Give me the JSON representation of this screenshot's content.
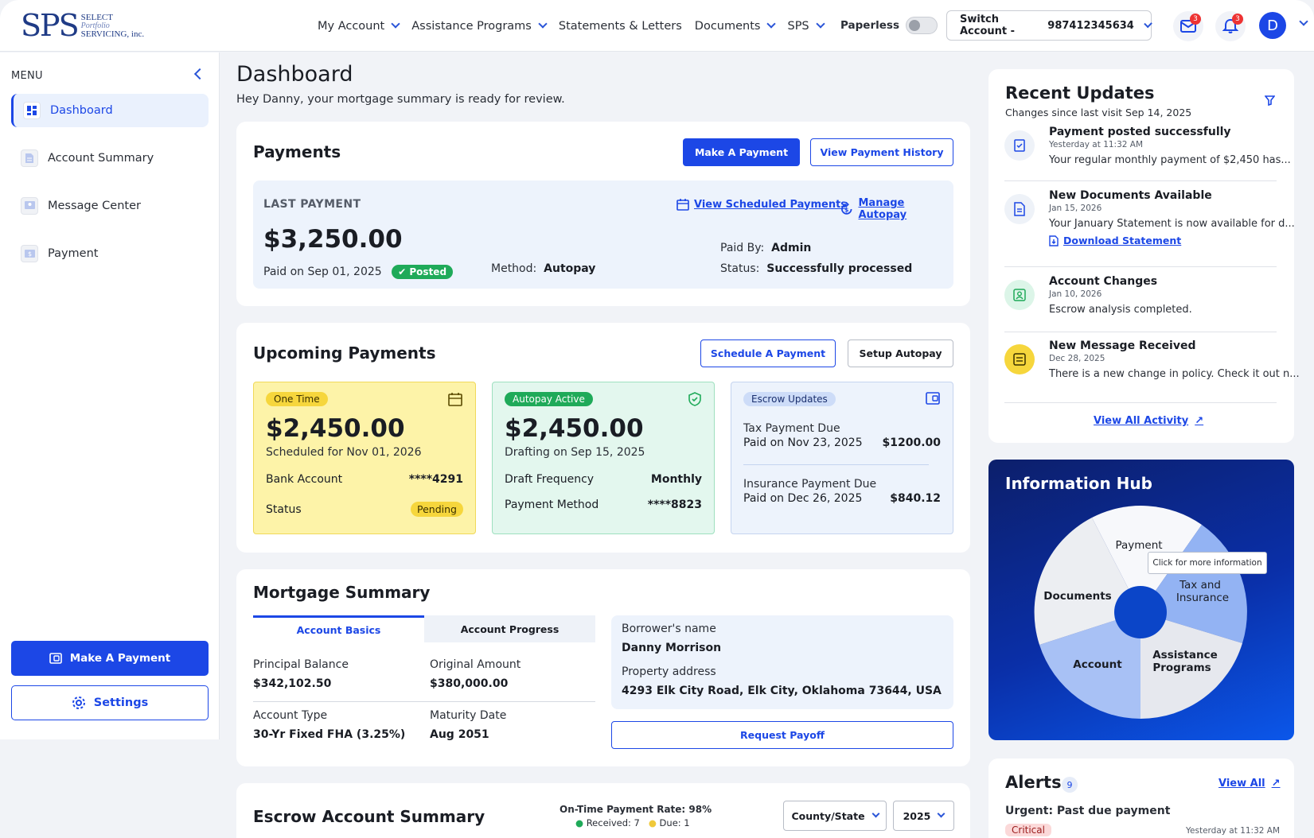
{
  "logo": {
    "mark": "SPS",
    "line1": "SELECT",
    "line2": "Portfolio",
    "line3": "SERVICING, inc."
  },
  "nav": [
    {
      "label": "My Account",
      "dropdown": true
    },
    {
      "label": "Assistance Programs",
      "dropdown": true
    },
    {
      "label": "Statements & Letters",
      "dropdown": false
    },
    {
      "label": "Documents",
      "dropdown": true
    },
    {
      "label": "SPS",
      "dropdown": true
    }
  ],
  "header": {
    "paperless_label": "Paperless",
    "switch_account": "Switch Account - ",
    "account_number": "987412345634",
    "mail_badge": "3",
    "bell_badge": "3",
    "avatar": "D"
  },
  "sidebar": {
    "menu_label": "MENU",
    "items": [
      {
        "label": "Dashboard",
        "active": true
      },
      {
        "label": "Account Summary",
        "active": false
      },
      {
        "label": "Message Center",
        "active": false
      },
      {
        "label": "Payment",
        "active": false
      }
    ],
    "make_payment": "Make A Payment",
    "settings": "Settings"
  },
  "page": {
    "title": "Dashboard",
    "subtitle": "Hey Danny, your mortgage summary is ready for review."
  },
  "payments": {
    "title": "Payments",
    "make_payment": "Make A Payment",
    "view_history": "View Payment History",
    "last_label": "LAST PAYMENT",
    "view_scheduled": "View Scheduled Payments",
    "manage_autopay": "Manage Autopay",
    "amount": "$3,250.00",
    "paid_on": "Paid on Sep 01, 2025",
    "posted": "Posted",
    "method_label": "Method:",
    "method_value": "Autopay",
    "paid_by_label": "Paid By:",
    "paid_by_value": "Admin",
    "status_label": "Status:",
    "status_value": "Successfully processed"
  },
  "upcoming": {
    "title": "Upcoming Payments",
    "schedule": "Schedule A Payment",
    "setup": "Setup Autopay",
    "one_time": {
      "tag": "One Time",
      "amount": "$2,450.00",
      "scheduled": "Scheduled for Nov 01, 2026",
      "bank_label": "Bank Account",
      "bank_value": "****4291",
      "status_label": "Status",
      "status_value": "Pending"
    },
    "autopay": {
      "tag": "Autopay Active",
      "amount": "$2,450.00",
      "drafting": "Drafting on Sep 15, 2025",
      "freq_label": "Draft Frequency",
      "freq_value": "Monthly",
      "method_label": "Payment Method",
      "method_value": "****8823"
    },
    "escrow": {
      "tag": "Escrow Updates",
      "tax_title": "Tax Payment Due",
      "tax_date": "Paid on Nov 23, 2025",
      "tax_amount": "$1200.00",
      "ins_title": "Insurance Payment Due",
      "ins_date": "Paid on Dec 26, 2025",
      "ins_amount": "$840.12"
    }
  },
  "mortgage": {
    "title": "Mortgage Summary",
    "tab_basics": "Account Basics",
    "tab_progress": "Account Progress",
    "principal_label": "Principal Balance",
    "principal_value": "$342,102.50",
    "original_label": "Original Amount",
    "original_value": "$380,000.00",
    "type_label": "Account Type",
    "type_value": "30-Yr Fixed FHA (3.25%)",
    "maturity_label": "Maturity Date",
    "maturity_value": "Aug 2051",
    "borrower_label": "Borrower's name",
    "borrower_value": "Danny Morrison",
    "property_label": "Property address",
    "property_value": "4293 Elk City Road, Elk City, Oklahoma 73644, USA",
    "request_payoff": "Request Payoff"
  },
  "escrow_summary": {
    "title": "Escrow Account Summary",
    "rate": "On-Time Payment Rate: 98%",
    "received": "Received: 7",
    "due": "Due: 1",
    "county": "County/State",
    "year": "2025"
  },
  "recent": {
    "title": "Recent Updates",
    "since": "Changes since last visit Sep 14, 2025",
    "items": [
      {
        "title": "Payment posted successfully",
        "time": "Yesterday at 11:32 AM",
        "desc": "Your regular monthly payment of $2,450 has..."
      },
      {
        "title": "New Documents Available",
        "time": "Jan 15, 2026",
        "desc": "Your January Statement is now available for d...",
        "link": "Download Statement"
      },
      {
        "title": "Account Changes",
        "time": "Jan 10, 2026",
        "desc": "Escrow analysis completed."
      },
      {
        "title": "New Message Received",
        "time": "Dec 28, 2025",
        "desc": "There is a new change in policy. Check it out n..."
      }
    ],
    "view_all": "View All Activity"
  },
  "hub": {
    "title": "Information Hub",
    "tooltip": "Click for more information",
    "segments": [
      "Payment",
      "Tax and",
      "Insurance",
      "Assistance",
      "Programs",
      "Account",
      "Documents"
    ]
  },
  "alerts": {
    "title": "Alerts",
    "count": "9",
    "view_all": "View All",
    "item_title": "Urgent: Past due payment",
    "item_tag": "Critical",
    "item_time": "Yesterday at 11:32 AM"
  },
  "colors": {
    "primary": "#1c47e6",
    "posted": "#1faa59",
    "one_time_bg": "#fdf3a8",
    "autopay_bg": "#e3f7ee",
    "escrow_bg": "#edf3fc"
  }
}
